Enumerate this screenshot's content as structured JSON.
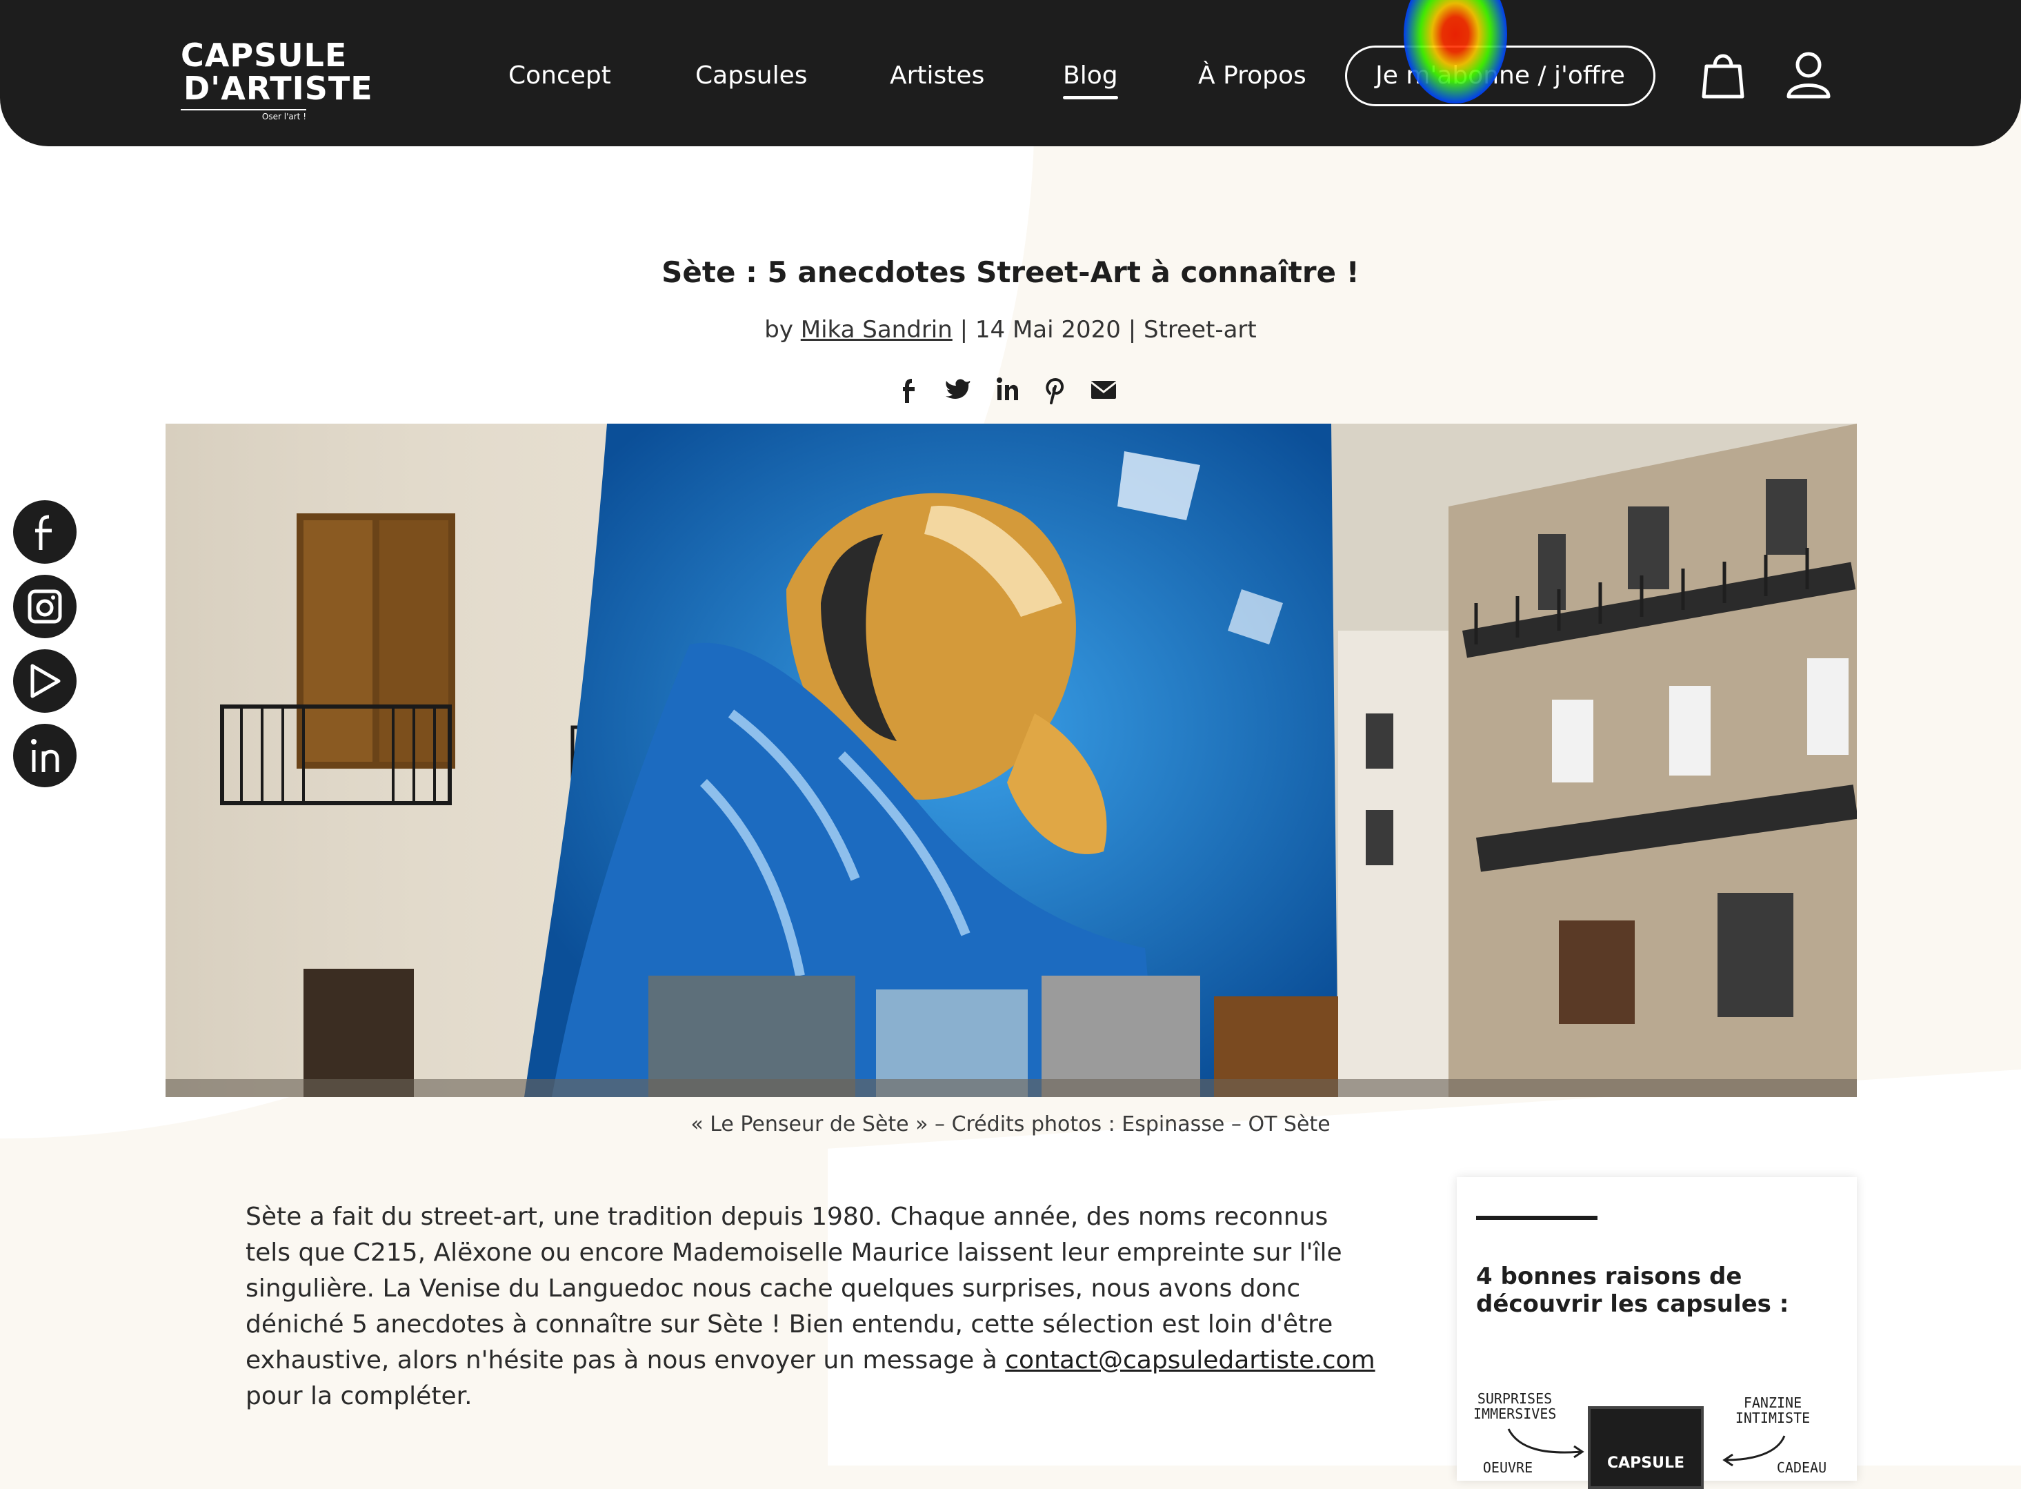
{
  "logo": {
    "line1": "CAPSULE",
    "line2": "D'ARTISTE",
    "tagline": "Oser l'art !"
  },
  "nav": {
    "items": [
      {
        "label": "Concept"
      },
      {
        "label": "Capsules"
      },
      {
        "label": "Artistes"
      },
      {
        "label": "Blog"
      },
      {
        "label": "À Propos"
      }
    ],
    "active": "Blog",
    "subscribe_label": "Je m'abonne / j'offre"
  },
  "header_icons": [
    "shopping-bag-icon",
    "user-account-icon"
  ],
  "social_sidebar": [
    "facebook-icon",
    "instagram-icon",
    "youtube-icon",
    "linkedin-icon"
  ],
  "article": {
    "title": "Sète : 5 anecdotes Street-Art à connaître !",
    "by": "by",
    "author": "Mika Sandrin",
    "date": "14 Mai 2020",
    "category": "Street-art",
    "share_icons": [
      "facebook-icon",
      "twitter-icon",
      "linkedin-icon",
      "pinterest-icon",
      "email-icon"
    ],
    "caption": "« Le Penseur de Sète » – Crédits photos : Espinasse – OT Sète",
    "body_before_link": "Sète a fait du street-art, une tradition depuis 1980. Chaque année, des noms reconnus tels que C215, Alëxone ou encore Mademoiselle Maurice laissent leur empreinte sur l'île singulière. La Venise du Languedoc nous cache quelques surprises, nous avons donc déniché 5 anecdotes à connaître sur Sète ! Bien entendu, cette sélection est loin d'être exhaustive, alors n'hésite pas à nous envoyer un message à",
    "email": "contact@capsuledartiste.com",
    "body_after_link": "pour la compléter."
  },
  "side_card": {
    "title": "4 bonnes raisons de découvrir les capsules :",
    "note1": "SURPRISES IMMERSIVES",
    "note2": "FANZINE INTIMISTE",
    "note3": "OEUVRE",
    "note4": "CADEAU",
    "box_label": "CAPSULE"
  },
  "colors": {
    "header_bg": "#1d1d1d",
    "page_bg": "#fbf8f2",
    "accent": "#ffffff"
  }
}
